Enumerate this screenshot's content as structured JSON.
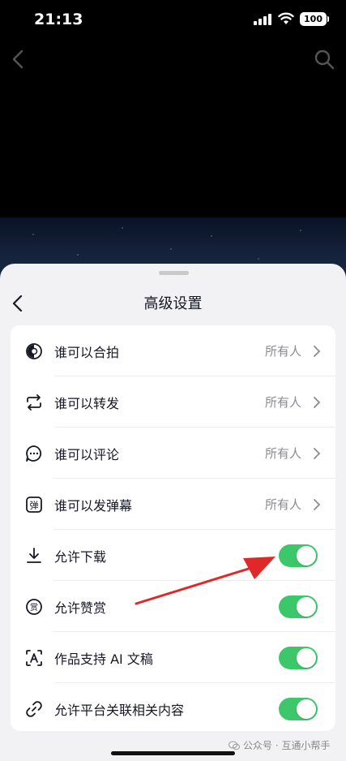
{
  "status_bar": {
    "time": "21:13",
    "battery": "100"
  },
  "sheet": {
    "title": "高级设置"
  },
  "settings": [
    {
      "label": "谁可以合拍",
      "value": "所有人",
      "type": "nav",
      "icon": "duet-icon"
    },
    {
      "label": "谁可以转发",
      "value": "所有人",
      "type": "nav",
      "icon": "repost-icon"
    },
    {
      "label": "谁可以评论",
      "value": "所有人",
      "type": "nav",
      "icon": "comment-icon"
    },
    {
      "label": "谁可以发弹幕",
      "value": "所有人",
      "type": "nav",
      "icon": "danmaku-icon"
    },
    {
      "label": "允许下载",
      "type": "toggle",
      "on": true,
      "icon": "download-icon"
    },
    {
      "label": "允许赞赏",
      "type": "toggle",
      "on": true,
      "icon": "reward-icon"
    },
    {
      "label": "作品支持 AI 文稿",
      "type": "toggle",
      "on": true,
      "icon": "ai-transcript-icon"
    },
    {
      "label": "允许平台关联相关内容",
      "type": "toggle",
      "on": true,
      "icon": "link-icon"
    }
  ],
  "colors": {
    "toggle_on": "#3dc76b",
    "annotation_arrow": "#e02828"
  },
  "watermark": {
    "text": "公众号 · 互通小帮手"
  }
}
